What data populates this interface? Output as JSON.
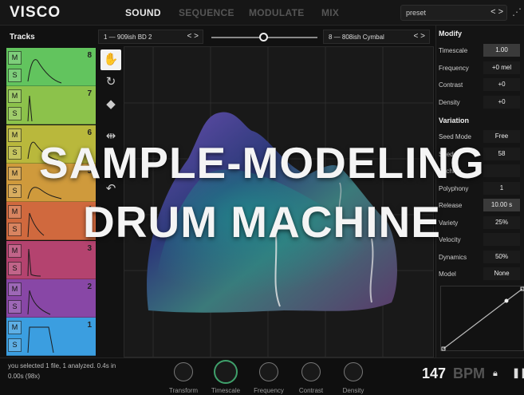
{
  "app": {
    "logo": "VISCO"
  },
  "nav": {
    "tabs": [
      {
        "label": "SOUND"
      },
      {
        "label": "SEQUENCE"
      },
      {
        "label": "MODULATE"
      },
      {
        "label": "MIX"
      }
    ]
  },
  "preset": {
    "label": "preset",
    "arrows": "< >"
  },
  "tracks": {
    "title": "Tracks",
    "mute_label": "M",
    "solo_label": "S",
    "items": [
      {
        "number": "8",
        "color": "#62c45e"
      },
      {
        "number": "7",
        "color": "#8cc24b"
      },
      {
        "number": "6",
        "color": "#b9b83c"
      },
      {
        "number": "5",
        "color": "#cf9a3c"
      },
      {
        "number": "4",
        "color": "#d0693e"
      },
      {
        "number": "3",
        "color": "#b4436f"
      },
      {
        "number": "2",
        "color": "#8847a6"
      },
      {
        "number": "1",
        "color": "#3b9ee0"
      }
    ]
  },
  "morph": {
    "left_sample": "1 — 909ish BD 2",
    "right_sample": "8 — 808ish Cymbal",
    "arrows": "< >",
    "position": 0.49
  },
  "tools": [
    "brush-icon",
    "lasso-icon",
    "eraser-icon",
    "mirror-icon",
    "undo-icon"
  ],
  "panel": {
    "modify_title": "Modify",
    "modify": [
      {
        "label": "Timescale",
        "value": "1.00"
      },
      {
        "label": "Frequency",
        "value": "+0 mel"
      },
      {
        "label": "Contrast",
        "value": "+0"
      },
      {
        "label": "Density",
        "value": "+0"
      }
    ],
    "variation_title": "Variation",
    "variation": [
      {
        "label": "Seed Mode",
        "value": "Free"
      },
      {
        "label": "Seed",
        "value": "58"
      },
      {
        "label": "Pitching",
        "value": ""
      },
      {
        "label": "Polyphony",
        "value": "1"
      },
      {
        "label": "Release",
        "value": "10.00 s"
      },
      {
        "label": "Variety",
        "value": "25%"
      },
      {
        "label": "Velocity",
        "value": ""
      },
      {
        "label": "Dynamics",
        "value": "50%"
      },
      {
        "label": "Model",
        "value": "None"
      }
    ]
  },
  "status": {
    "line1": "you selected 1 file, 1 analyzed. 0.4s in",
    "line2": "0.00s (98x)"
  },
  "knobs": [
    {
      "label": "Transform"
    },
    {
      "label": "Timescale"
    },
    {
      "label": "Frequency"
    },
    {
      "label": "Contrast"
    },
    {
      "label": "Density"
    }
  ],
  "transport": {
    "bpm": "147",
    "bpm_unit": "BPM"
  },
  "overlay": {
    "line1": "SAMPLE-MODELING",
    "line2": "DRUM MACHINE"
  }
}
